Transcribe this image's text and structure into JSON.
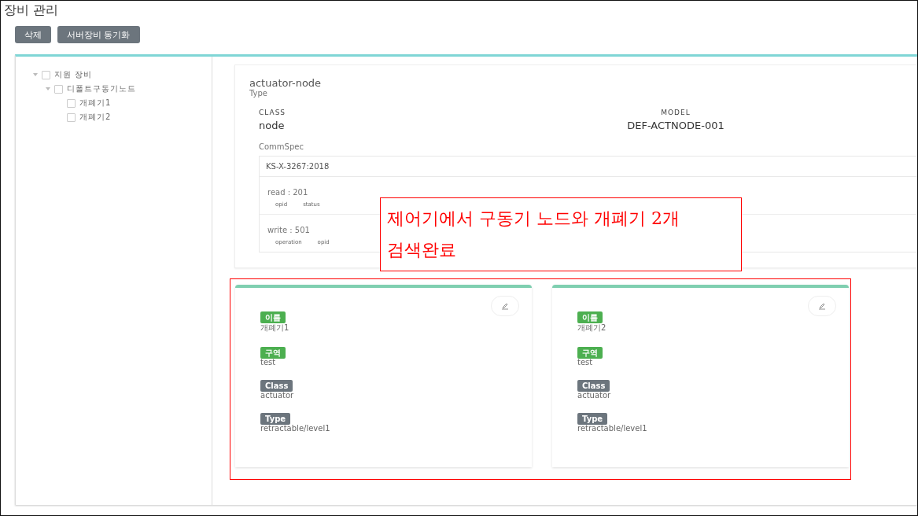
{
  "page_title": "장비 관리",
  "toolbar": [
    {
      "label": "삭제"
    },
    {
      "label": "서버장비 동기화"
    }
  ],
  "tree": [
    {
      "label": "지원 장비",
      "expanded": true,
      "checked": false,
      "children": [
        {
          "label": "디폴트구동기노드",
          "expanded": true,
          "checked": false,
          "children": [
            {
              "label": "개폐기1",
              "checked": false
            },
            {
              "label": "개폐기2",
              "checked": false
            }
          ]
        }
      ]
    }
  ],
  "detail": {
    "name": "actuator-node",
    "name_caption": "Type",
    "fields": [
      {
        "label": "CLASS",
        "value": "node"
      },
      {
        "label": "MODEL",
        "value": "DEF-ACTNODE-001"
      }
    ],
    "commspec_label": "CommSpec",
    "commspec_title": "KS-X-3267:2018",
    "commspec_items": [
      {
        "title": "read : 201",
        "params": [
          "opid",
          "status"
        ]
      },
      {
        "title": "write : 501",
        "params": [
          "operation",
          "opid"
        ]
      }
    ]
  },
  "annotation": {
    "lines": [
      "제어기에서 구동기 노드와 개폐기 2개",
      "검색완료"
    ]
  },
  "devices": [
    {
      "fields": [
        {
          "tag": "이름",
          "color": "#4caf50",
          "value": "개폐기1"
        },
        {
          "tag": "구역",
          "color": "#4caf50",
          "value": "test"
        },
        {
          "tag": "Class",
          "color": "#6c757d",
          "value": "actuator"
        },
        {
          "tag": "Type",
          "color": "#6c757d",
          "value": "retractable/level1"
        }
      ]
    },
    {
      "fields": [
        {
          "tag": "이름",
          "color": "#4caf50",
          "value": "개폐기2"
        },
        {
          "tag": "구역",
          "color": "#4caf50",
          "value": "test"
        },
        {
          "tag": "Class",
          "color": "#6c757d",
          "value": "actuator"
        },
        {
          "tag": "Type",
          "color": "#6c757d",
          "value": "retractable/level1"
        }
      ]
    }
  ]
}
